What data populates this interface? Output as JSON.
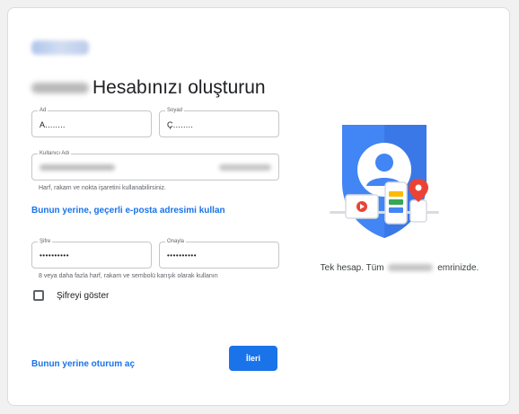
{
  "page": {
    "title": "Hesabınızı oluşturun"
  },
  "form": {
    "first_name": {
      "label": "Ad",
      "value": "A........"
    },
    "last_name": {
      "label": "Soyad",
      "value": "Ç........"
    },
    "username": {
      "label": "Kullanıcı Adı"
    },
    "username_hint": "Harf, rakam ve nokta işaretini kullanabilirsiniz.",
    "use_existing_email_link": "Bunun yerine, geçerli e-posta adresimi kullan",
    "password": {
      "label": "Şifre",
      "value": "••••••••••"
    },
    "confirm": {
      "label": "Onayla",
      "value": "••••••••••"
    },
    "password_hint": "8 veya daha fazla harf, rakam ve sembolü karışık olarak kullanın",
    "show_password_label": "Şifreyi göster",
    "sign_in_instead_link": "Bunun yerine oturum aç",
    "next_button": "İleri"
  },
  "side": {
    "tagline_prefix": "Tek hesap. Tüm",
    "tagline_suffix": "emrinizde."
  },
  "colors": {
    "accent": "#1a73e8",
    "shield": "#4285f4",
    "red": "#ea4335",
    "yellow": "#fbbc04",
    "green": "#34a853"
  }
}
